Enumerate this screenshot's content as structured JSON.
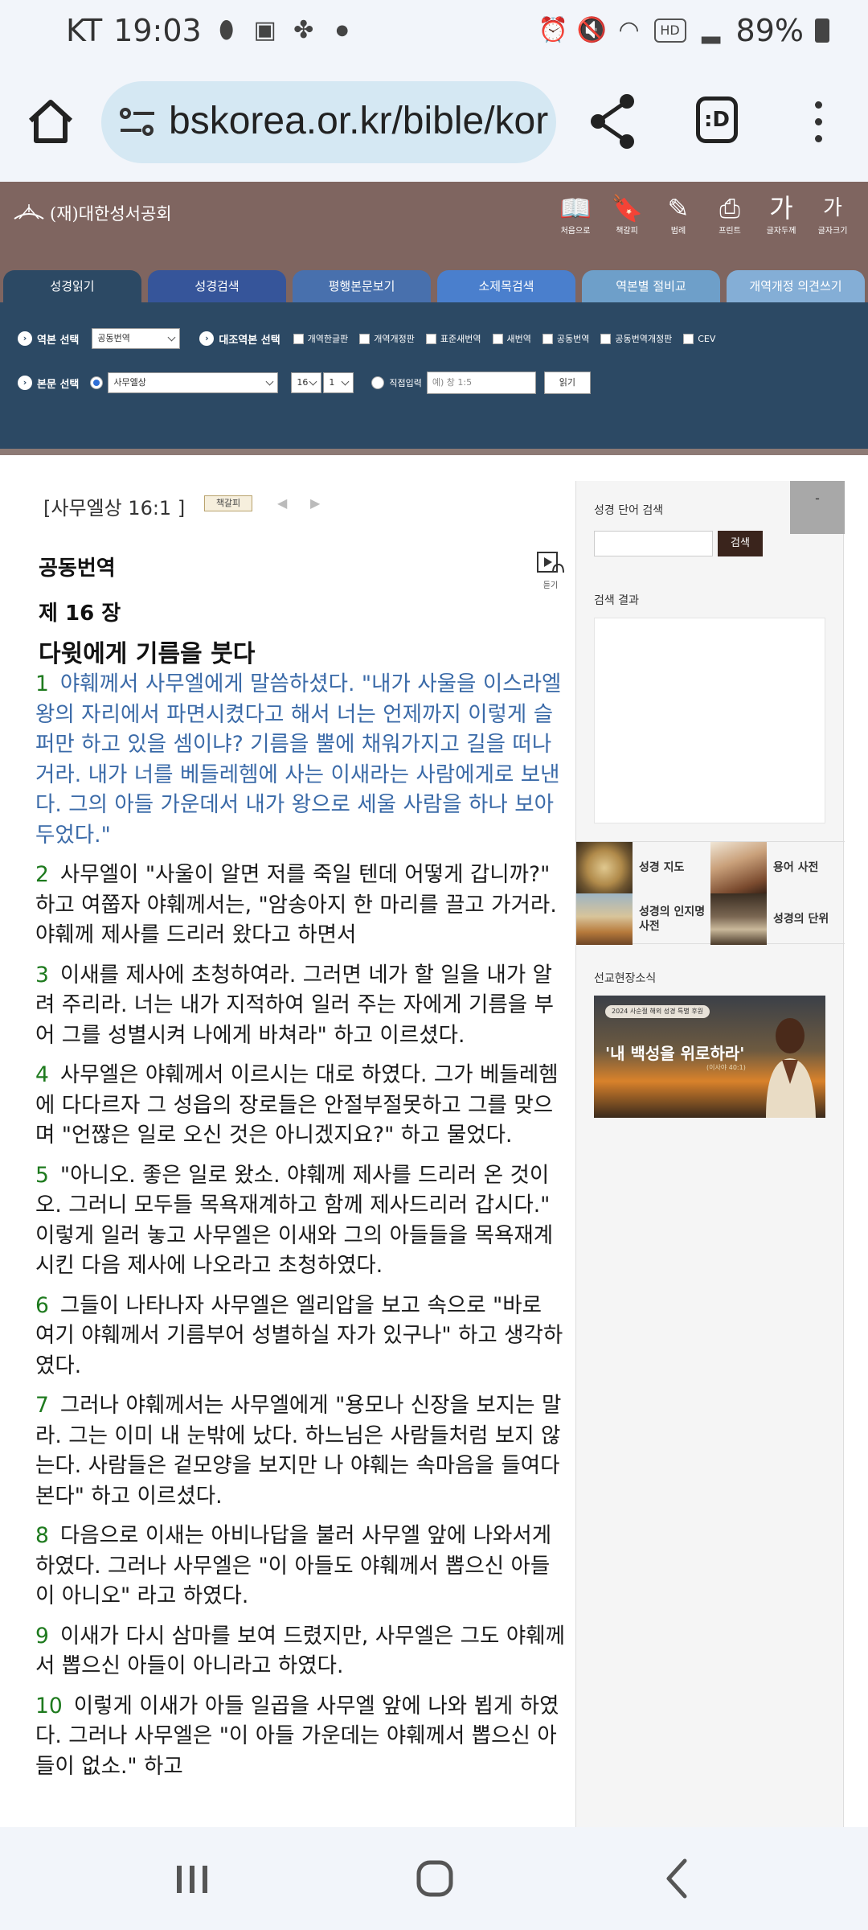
{
  "status_bar": {
    "carrier": "KT",
    "time": "19:03",
    "battery": "89%"
  },
  "browser": {
    "url": "bskorea.or.kr/bible/kor",
    "tabs_label": ":D"
  },
  "site": {
    "logo": "(재)대한성서공회",
    "tools": [
      {
        "icon": "book-icon",
        "label": "처음으로"
      },
      {
        "icon": "bookmark-icon",
        "label": "책갈피"
      },
      {
        "icon": "stamp-icon",
        "label": "범례"
      },
      {
        "icon": "printer-icon",
        "label": "프린트"
      },
      {
        "icon": "font-large-icon",
        "label": "글자두께"
      },
      {
        "icon": "font-size-icon",
        "label": "글자크기"
      }
    ],
    "tabs": [
      "성경읽기",
      "성경검색",
      "평행본문보기",
      "소제목검색",
      "역본별 절비교",
      "개역개정 의견쓰기"
    ],
    "selector": {
      "version_label": "역본 선택",
      "version_value": "공동번역",
      "compare_label": "대조역본 선택",
      "compare_options": [
        "개역한글판",
        "개역개정판",
        "표준새번역",
        "새번역",
        "공동번역",
        "공동번역개정판",
        "CEV"
      ],
      "text_label": "본문 선택",
      "book_value": "사무엘상",
      "chapter_value": "16",
      "verse_value": "1",
      "direct_label": "직접입력",
      "direct_placeholder": "예) 창 1:5",
      "read_button": "읽기"
    }
  },
  "content": {
    "reference": "[사무엘상 16:1 ]",
    "bookmark_label": "책갈피",
    "listen_label": "듣기",
    "version_name": "공동번역",
    "chapter_title": "제 16 장",
    "section_heading": "다윗에게 기름을 붓다",
    "verses": [
      {
        "num": "1",
        "text": "야훼께서 사무엘에게 말씀하셨다. \"내가 사울을 이스라엘 왕의 자리에서 파면시켰다고 해서 너는 언제까지 이렇게 슬퍼만 하고 있을 셈이냐? 기름을 뿔에 채워가지고 길을 떠나거라. 내가 너를 베들레헴에 사는 이새라는 사람에게로 보낸다. 그의 아들 가운데서 내가 왕으로 세울 사람을 하나 보아 두었다.\""
      },
      {
        "num": "2",
        "text": "사무엘이 \"사울이 알면 저를 죽일 텐데 어떻게 갑니까?\" 하고 여쭙자 야훼께서는, \"암송아지 한 마리를 끌고 가거라. 야훼께 제사를 드리러 왔다고 하면서"
      },
      {
        "num": "3",
        "text": "이새를 제사에 초청하여라. 그러면 네가 할 일을 내가 알려 주리라. 너는 내가 지적하여 일러 주는 자에게 기름을 부어 그를 성별시켜 나에게 바쳐라\" 하고 이르셨다."
      },
      {
        "num": "4",
        "text": "사무엘은 야훼께서 이르시는 대로 하였다. 그가 베들레헴에 다다르자 그 성읍의 장로들은 안절부절못하고 그를 맞으며 \"언짢은 일로 오신 것은 아니겠지요?\" 하고 물었다."
      },
      {
        "num": "5",
        "text": "\"아니오. 좋은 일로 왔소. 야훼께 제사를 드리러 온 것이오. 그러니 모두들 목욕재계하고 함께 제사드리러 갑시다.\" 이렇게 일러 놓고 사무엘은 이새와 그의 아들들을 목욕재계시킨 다음 제사에 나오라고 초청하였다."
      },
      {
        "num": "6",
        "text": "그들이 나타나자 사무엘은 엘리압을 보고 속으로 \"바로 여기 야훼께서 기름부어 성별하실 자가 있구나\" 하고 생각하였다."
      },
      {
        "num": "7",
        "text": "그러나 야훼께서는 사무엘에게 \"용모나 신장을 보지는 말라. 그는 이미 내 눈밖에 났다. 하느님은 사람들처럼 보지 않는다. 사람들은 겉모양을 보지만 나 야훼는 속마음을 들여다 본다\" 하고 이르셨다."
      },
      {
        "num": "8",
        "text": "다음으로 이새는 아비나답을 불러 사무엘 앞에 나와서게 하였다. 그러나 사무엘은 \"이 아들도 야훼께서 뽑으신 아들이 아니오\" 라고 하였다."
      },
      {
        "num": "9",
        "text": "이새가 다시 삼마를 보여 드렸지만, 사무엘은 그도 야훼께서 뽑으신 아들이 아니라고 하였다."
      },
      {
        "num": "10",
        "text": "이렇게 이새가 아들 일곱을 사무엘 앞에 나와 뵙게 하였다. 그러나 사무엘은 \"이 아들 가운데는 야훼께서 뽑으신 아들이 없소.\" 하고"
      }
    ]
  },
  "sidebar": {
    "search_title": "성경 단어 검색",
    "close_label": "-",
    "search_button": "검색",
    "results_title": "검색 결과",
    "quick_links": [
      "성경 지도",
      "용어 사전",
      "성경의 인지명 사전",
      "성경의 단위"
    ],
    "mission_title": "선교현장소식",
    "banner_pill": "2024 사순절 해외 성경 특별 후원",
    "banner_main": "'내 백성을 위로하라'",
    "banner_sub": "(이사야 40:1)"
  },
  "colors": {
    "header_brown": "#7f6560",
    "selector_navy": "#2c4964",
    "tab_blue": "#3c5f99",
    "verse_number_green": "#1e7a1e",
    "highlight_blue": "#3a6aa8"
  }
}
